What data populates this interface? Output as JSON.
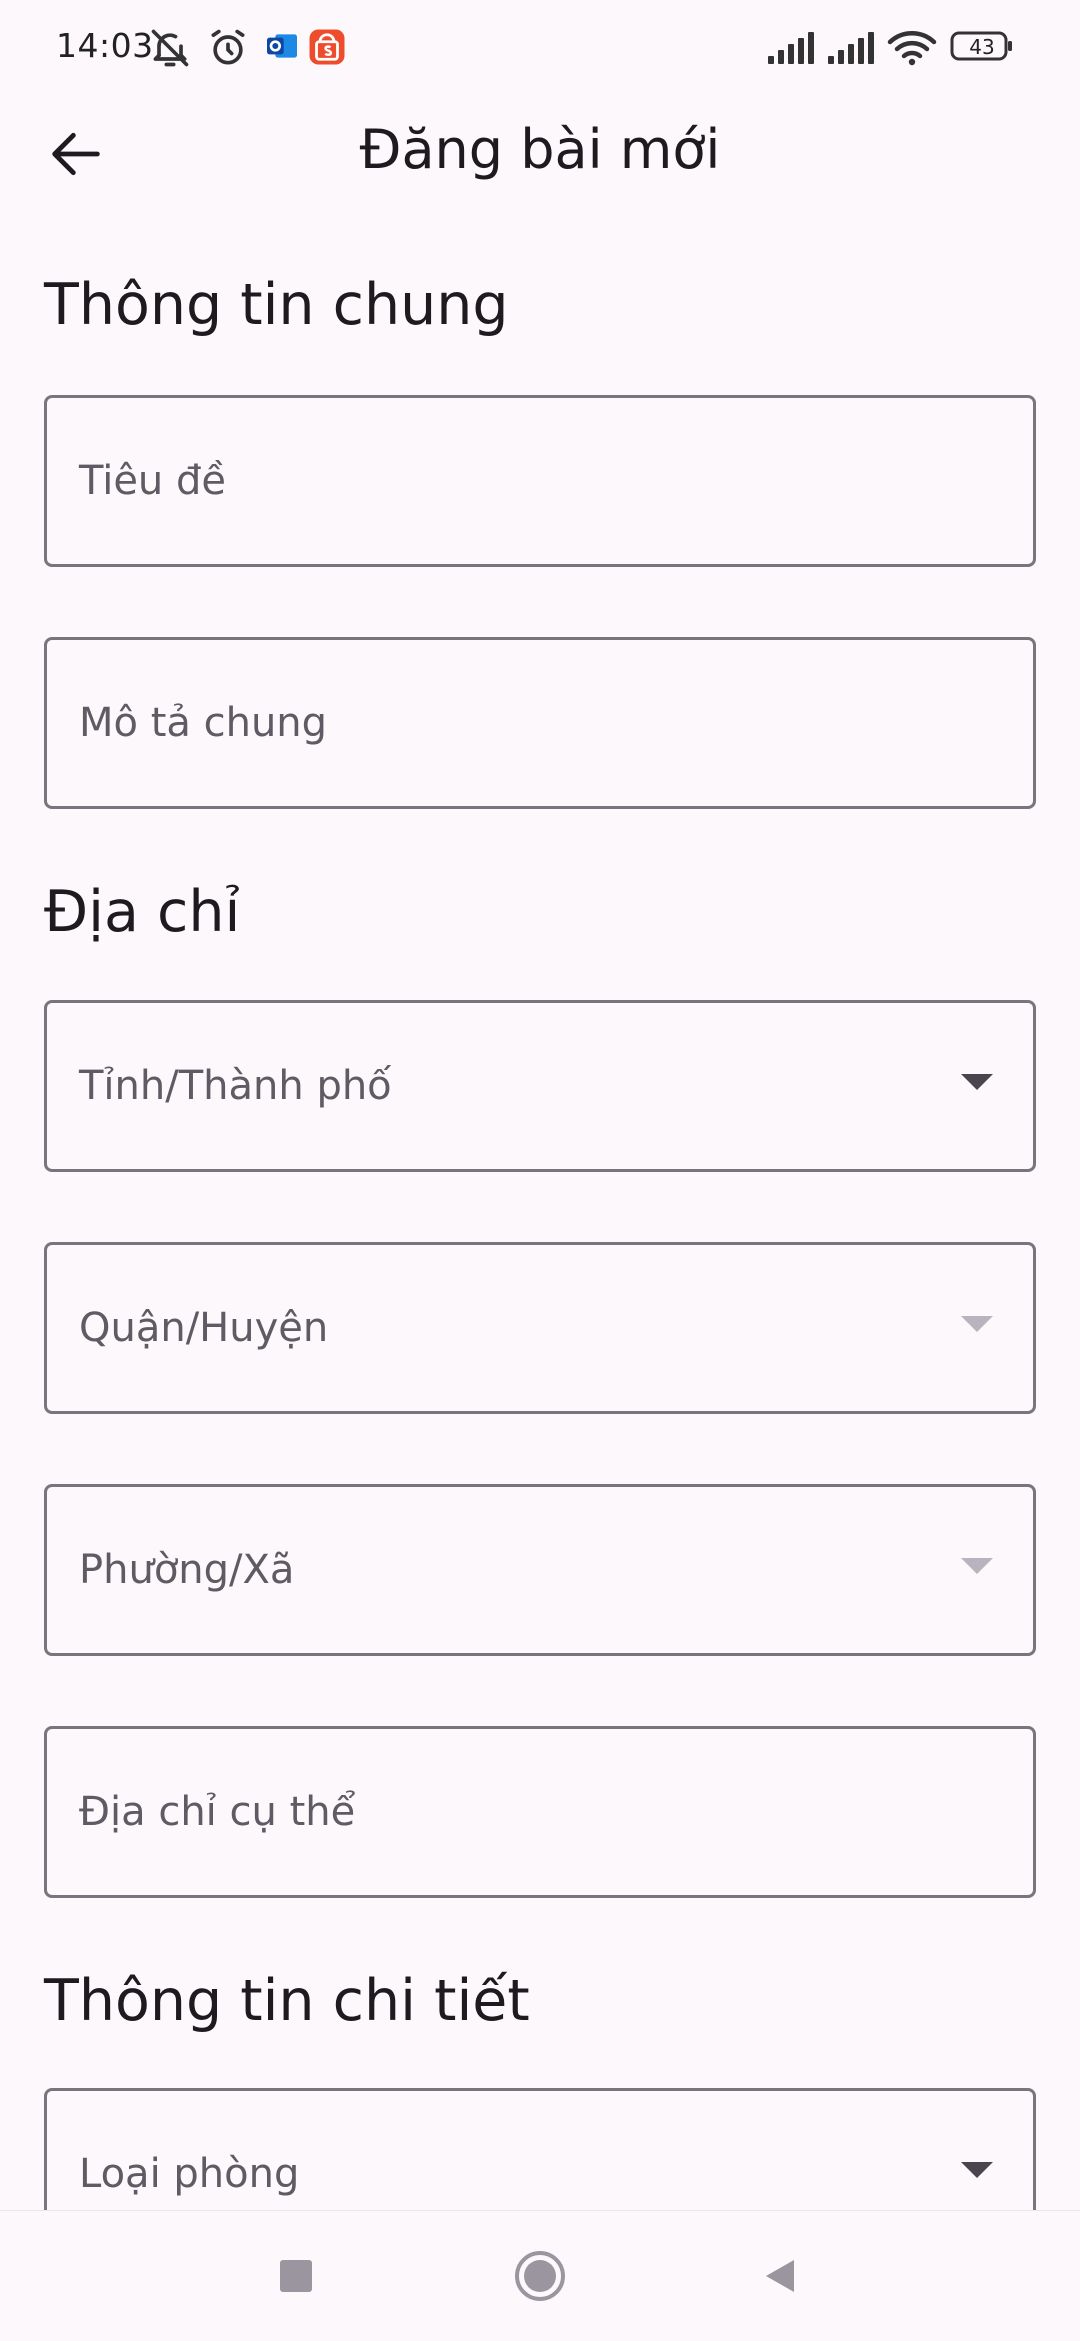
{
  "status_bar": {
    "time": "14:03",
    "battery_level": "43",
    "icons": [
      "bell-off-icon",
      "alarm-icon",
      "outlook-icon",
      "shopee-icon",
      "signal-icon",
      "signal-icon",
      "wifi-icon",
      "battery-icon"
    ]
  },
  "app_bar": {
    "title": "Đăng bài mới",
    "back_icon": "arrow-left-icon"
  },
  "sections": {
    "general": {
      "title": "Thông tin chung",
      "fields": {
        "title": {
          "placeholder": "Tiêu đề",
          "value": ""
        },
        "description": {
          "placeholder": "Mô tả chung",
          "value": ""
        }
      }
    },
    "address": {
      "title": "Địa chỉ",
      "fields": {
        "province": {
          "placeholder": "Tỉnh/Thành phố",
          "enabled": true
        },
        "district": {
          "placeholder": "Quận/Huyện",
          "enabled": false
        },
        "ward": {
          "placeholder": "Phường/Xã",
          "enabled": false
        },
        "street": {
          "placeholder": "Địa chỉ cụ thể",
          "value": ""
        }
      }
    },
    "details": {
      "title": "Thông tin chi tiết",
      "fields": {
        "room_type": {
          "placeholder": "Loại phòng",
          "enabled": true
        }
      }
    }
  },
  "nav_bar": {
    "icons": [
      "recents-icon",
      "home-icon",
      "back-triangle-icon"
    ]
  },
  "colors": {
    "background": "#fdf8fc",
    "outline": "#79747e",
    "label": "#5f5a63",
    "disabled_arrow": "#b8b3bd"
  }
}
